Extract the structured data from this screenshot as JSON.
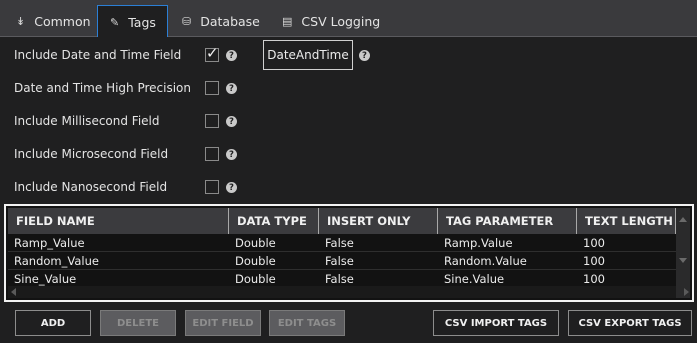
{
  "tabs": [
    {
      "label": "Common",
      "icon": "chevrons-icon"
    },
    {
      "label": "Tags",
      "icon": "tag-icon"
    },
    {
      "label": "Database",
      "icon": "database-icon"
    },
    {
      "label": "CSV Logging",
      "icon": "csv-file-icon"
    }
  ],
  "active_tab": "Tags",
  "options": [
    {
      "label": "Include Date and Time Field",
      "checked": true
    },
    {
      "label": "Date and Time High Precision",
      "checked": false
    },
    {
      "label": "Include Millisecond Field",
      "checked": false
    },
    {
      "label": "Include Microsecond Field",
      "checked": false
    },
    {
      "label": "Include Nanosecond Field",
      "checked": false
    }
  ],
  "date_time_field_value": "DateAndTime",
  "grid": {
    "columns": [
      "FIELD NAME",
      "DATA TYPE",
      "INSERT ONLY",
      "TAG PARAMETER",
      "TEXT LENGTH"
    ],
    "rows": [
      [
        "Ramp_Value",
        "Double",
        "False",
        "Ramp.Value",
        "100"
      ],
      [
        "Random_Value",
        "Double",
        "False",
        "Random.Value",
        "100"
      ],
      [
        "Sine_Value",
        "Double",
        "False",
        "Sine.Value",
        "100"
      ]
    ]
  },
  "buttons": {
    "add": "ADD",
    "delete": "DELETE",
    "edit_field": "EDIT FIELD",
    "edit_tags": "EDIT TAGS",
    "csv_import": "CSV IMPORT TAGS",
    "csv_export": "CSV EXPORT TAGS"
  },
  "help_glyph": "?",
  "colors": {
    "accent": "#2b7fd6",
    "background": "#1f1f20",
    "tabbar": "#3a3a3d",
    "disabled_button": "#5c5c5f"
  }
}
